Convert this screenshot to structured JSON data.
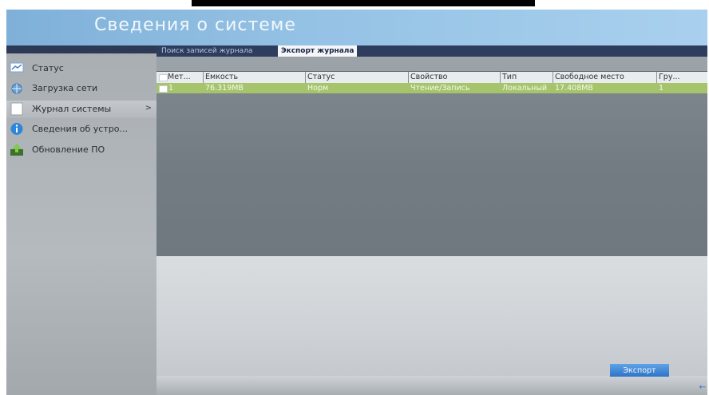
{
  "window": {
    "title": "Сведения о системе"
  },
  "sidebar": {
    "items": [
      {
        "label": "Статус",
        "icon": "status-icon",
        "active": false
      },
      {
        "label": "Загрузка сети",
        "icon": "network-icon",
        "active": false
      },
      {
        "label": "Журнал системы",
        "icon": "log-icon",
        "active": true,
        "arrow": ">"
      },
      {
        "label": "Сведения об устро...",
        "icon": "info-icon",
        "active": false
      },
      {
        "label": "Обновление ПО",
        "icon": "upgrade-icon",
        "active": false
      }
    ]
  },
  "tabs": [
    {
      "label": "Поиск записей журнала",
      "active": false
    },
    {
      "label": "Экспорт журнала",
      "active": true
    }
  ],
  "table": {
    "headers": [
      "Мет...",
      "Емкость",
      "Статус",
      "Свойство",
      "Тип",
      "Свободное место",
      "Гру..."
    ],
    "rows": [
      {
        "cells": [
          "1",
          "76.319MB",
          "Норм",
          "Чтение/Запись",
          "Локальный",
          "17.408MB",
          "1"
        ]
      }
    ]
  },
  "actions": {
    "export_label": "Экспорт"
  },
  "colors": {
    "accent": "#2f74c7",
    "selected_row": "#a6c46c",
    "tab_bar": "#2e3d5e",
    "title_bar": "#93c1e4"
  }
}
